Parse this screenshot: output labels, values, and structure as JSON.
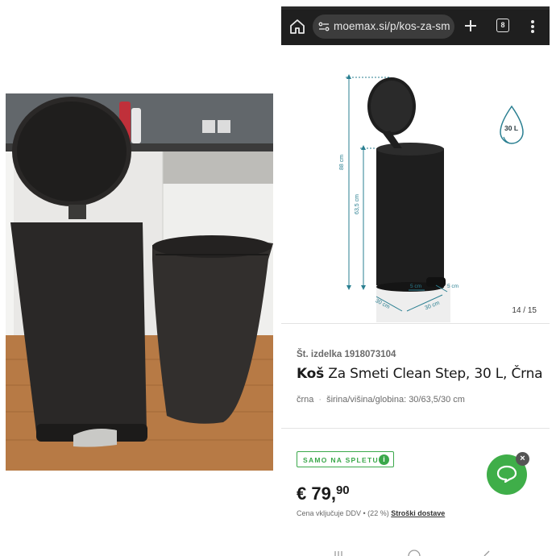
{
  "browser": {
    "url": "moemax.si/p/kos-za-sm",
    "tab_count": "8"
  },
  "gallery": {
    "counter": "14 / 15",
    "capacity_badge": "30 L",
    "dimension_labels": {
      "total_height": "88 cm",
      "body_height": "63,5 cm",
      "depth": "30 cm",
      "width": "30 cm",
      "pedal_a": "5 cm",
      "pedal_b": "5 cm"
    }
  },
  "product": {
    "sku_label": "Št. izdelka",
    "sku_value": "1918073104",
    "brand": "Koš",
    "title_rest": "Za Smeti Clean Step, 30 L, Črna",
    "color": "črna",
    "dimensions": "širina/višina/globina: 30/63,5/30 cm",
    "online_badge": "SAMO NA SPLETU",
    "price_main": "€ 79,",
    "price_cents": "90",
    "vat_text": "Cena vključuje DDV • (22 %)",
    "shipping_link": "Stroški dostave"
  },
  "colors": {
    "accent_green": "#3aa84a",
    "dimension_teal": "#2a7f91",
    "chrome_dark": "#1f1f1f"
  },
  "icons": {
    "home": "home-icon",
    "site_info": "site-settings-icon",
    "new_tab": "plus-icon",
    "tabs": "tab-switcher-icon",
    "menu": "more-vert-icon",
    "chat": "chat-icon",
    "close": "close-icon",
    "info": "info-icon"
  }
}
